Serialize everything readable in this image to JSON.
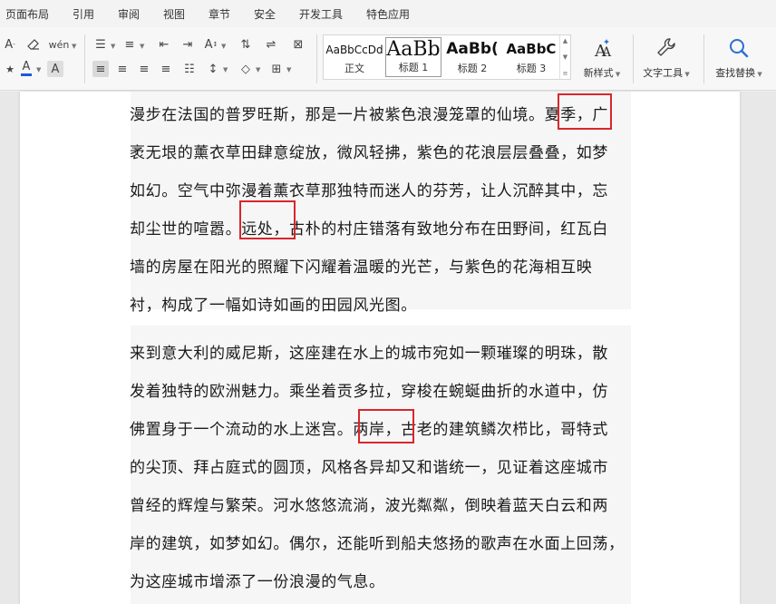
{
  "menu": {
    "items": [
      "页面布局",
      "引用",
      "审阅",
      "视图",
      "章节",
      "安全",
      "开发工具",
      "特色应用"
    ]
  },
  "ribbon": {
    "styles": [
      {
        "sample": "AaBbCcDd",
        "label": "正文"
      },
      {
        "sample": "AaBb",
        "label": "标题 1"
      },
      {
        "sample": "AaBb(",
        "label": "标题 2"
      },
      {
        "sample": "AaBbC",
        "label": "标题 3"
      }
    ],
    "new_style_label": "新样式",
    "text_tools_label": "文字工具",
    "find_replace_label": "查找替换",
    "colors": {
      "font_color": "#1f5ad6",
      "highlight_border": "#d9262b"
    }
  },
  "document": {
    "paragraphs": [
      {
        "lines": [
          "漫步在法国的普罗旺斯，那是一片被紫色浪漫笼罩的仙境。夏季，广",
          "袤无垠的薰衣草田肆意绽放，微风轻拂，紫色的花浪层层叠叠，如梦",
          "如幻。空气中弥漫着薰衣草那独特而迷人的芬芳，让人沉醉其中，忘",
          "却尘世的喧嚣。远处，古朴的村庄错落有致地分布在田野间，红瓦白",
          "墙的房屋在阳光的照耀下闪耀着温暖的光芒，与紫色的花海相互映",
          "衬，构成了一幅如诗如画的田园风光图。"
        ]
      },
      {
        "lines": [
          "来到意大利的威尼斯，这座建在水上的城市宛如一颗璀璨的明珠，散",
          "发着独特的欧洲魅力。乘坐着贡多拉，穿梭在蜿蜒曲折的水道中，仿",
          "佛置身于一个流动的水上迷宫。两岸，古老的建筑鳞次栉比，哥特式",
          "的尖顶、拜占庭式的圆顶，风格各异却又和谐统一，见证着这座城市",
          "曾经的辉煌与繁荣。河水悠悠流淌，波光粼粼，倒映着蓝天白云和两",
          "岸的建筑，如梦如幻。偶尔，还能听到船夫悠扬的歌声在水面上回荡，",
          "为这座城市增添了一份浪漫的气息。"
        ]
      }
    ]
  }
}
